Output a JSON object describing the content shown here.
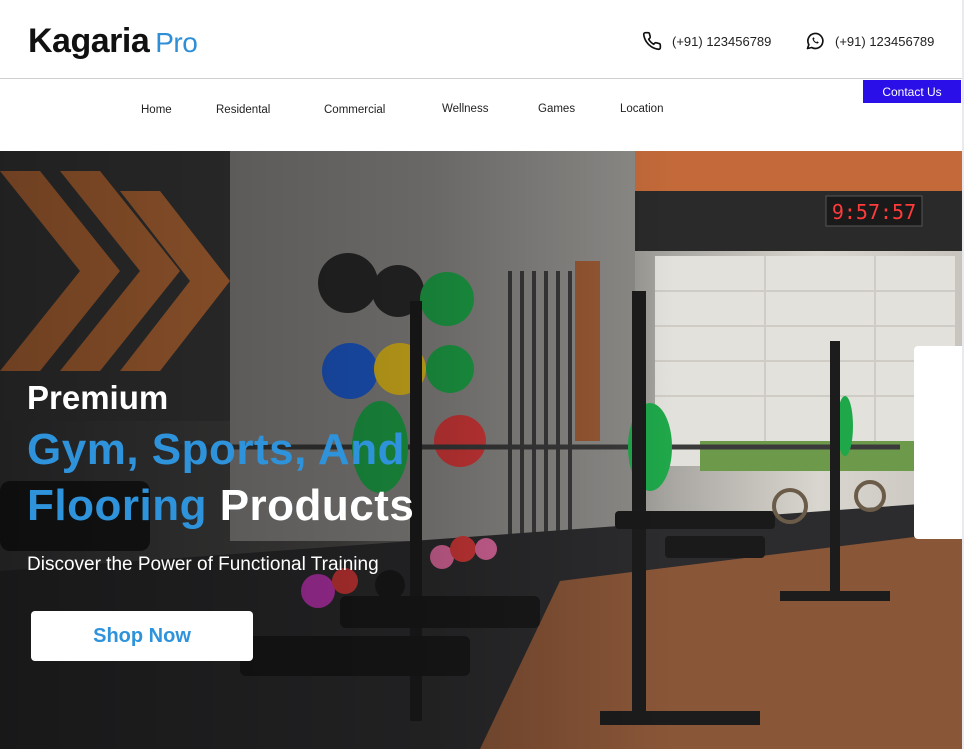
{
  "header": {
    "brand": "Kagaria",
    "brand_suffix": "Pro",
    "phone_number": "(+91) 123456789",
    "whatsapp_number": "(+91) 123456789",
    "phone_icon": "phone-icon",
    "whatsapp_icon": "whatsapp-icon"
  },
  "nav": {
    "items": [
      {
        "label": "Home"
      },
      {
        "label": "Residental"
      },
      {
        "label": "Commercial"
      },
      {
        "label": "Wellness"
      },
      {
        "label": "Games"
      },
      {
        "label": "Location"
      }
    ],
    "contact_label": "Contact Us"
  },
  "hero": {
    "eyebrow": "Premium",
    "headline_blue": "Gym, Sports, And",
    "headline_blue_2": "Flooring",
    "headline_white": "Products",
    "subheading": "Discover the Power of Functional Training",
    "cta_label": "Shop Now",
    "clock_readout": "9:57:57"
  },
  "colors": {
    "accent_blue": "#2e93db",
    "contact_button": "#2b0fe8",
    "plate_green": "#1fa84a",
    "plate_blue": "#1f5fd6",
    "plate_red": "#d83a3a",
    "plate_yellow": "#e8c21f"
  }
}
